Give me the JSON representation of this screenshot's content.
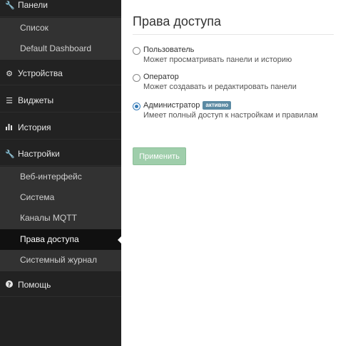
{
  "sidebar": {
    "sections": {
      "panels": {
        "label": "Панели",
        "icon": "wrench-icon"
      },
      "devices": {
        "label": "Устройства",
        "icon": "gear-icon"
      },
      "widgets": {
        "label": "Виджеты",
        "icon": "list-icon"
      },
      "history": {
        "label": "История",
        "icon": "bar-chart-icon"
      },
      "settings": {
        "label": "Настройки",
        "icon": "wrench-icon"
      },
      "help": {
        "label": "Помощь",
        "icon": "question-circle-icon"
      }
    },
    "panels_items": [
      "Список",
      "Default Dashboard"
    ],
    "settings_items": [
      "Веб-интерфейс",
      "Система",
      "Каналы MQTT",
      "Права доступа",
      "Системный журнал"
    ],
    "active_item": "Права доступа"
  },
  "main": {
    "title": "Права доступа",
    "options": [
      {
        "title": "Пользователь",
        "desc": "Может просматривать панели и историю",
        "checked": false
      },
      {
        "title": "Оператор",
        "desc": "Может создавать и редактировать панели",
        "checked": false
      },
      {
        "title": "Администратор",
        "desc": "Имеет полный доступ к настройкам и правилам",
        "checked": true,
        "badge": "активно"
      }
    ],
    "apply_label": "Применить"
  },
  "colors": {
    "sidebar_bg": "#222222",
    "submenu_bg": "#323232",
    "active_bg": "#101010",
    "accent": "#337ab7",
    "badge": "#5b8aa3",
    "apply_button": "#9fceab"
  }
}
